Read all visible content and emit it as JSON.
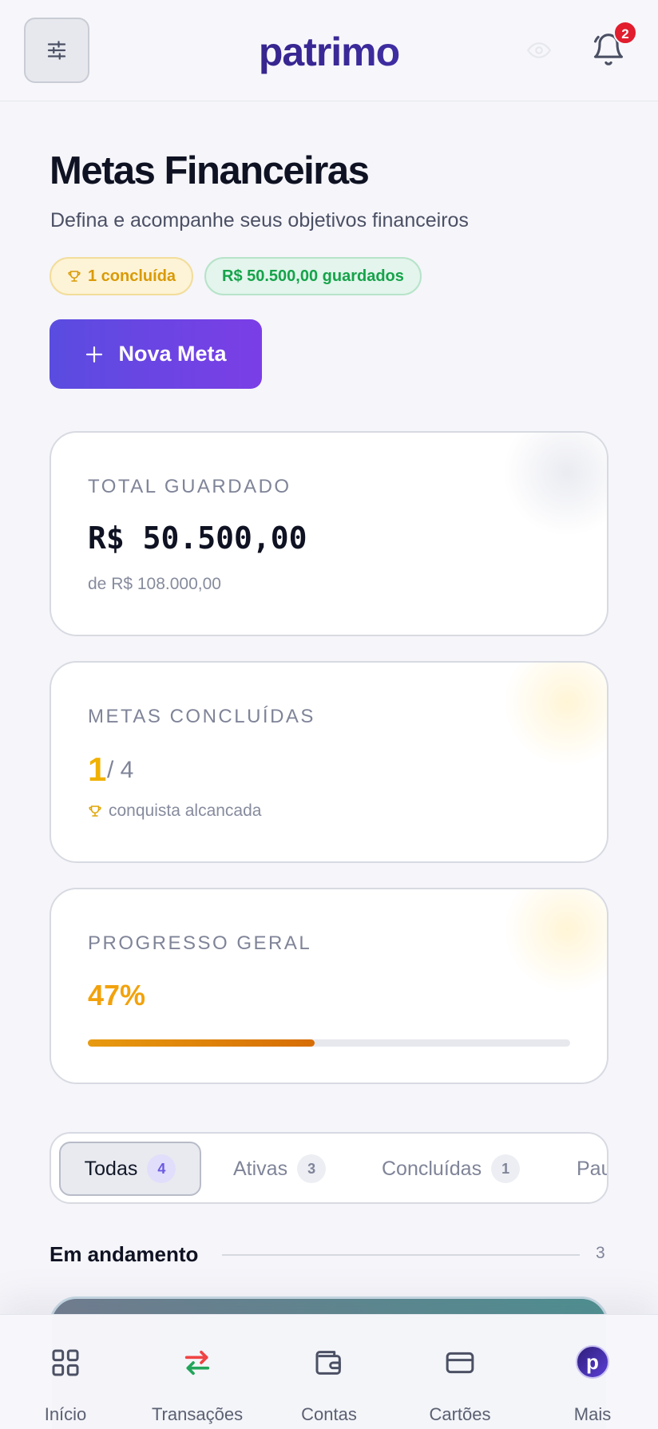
{
  "header": {
    "logo": "patrimo",
    "notification_count": "2"
  },
  "page": {
    "title": "Metas Financeiras",
    "subtitle": "Defina e acompanhe seus objetivos financeiros",
    "chip_completed": "1 concluída",
    "chip_saved": "R$ 50.500,00 guardados",
    "new_button": "Nova Meta"
  },
  "cards": {
    "total": {
      "label": "TOTAL GUARDADO",
      "value": "R$ 50.500,00",
      "sub": "de R$ 108.000,00"
    },
    "completed": {
      "label": "METAS CONCLUÍDAS",
      "done": "1",
      "total": "/ 4",
      "note": "conquista alcancada"
    },
    "progress": {
      "label": "PROGRESSO GERAL",
      "percent_text": "47%",
      "fraction": 0.47
    }
  },
  "tabs": [
    {
      "label": "Todas",
      "count": "4"
    },
    {
      "label": "Ativas",
      "count": "3"
    },
    {
      "label": "Concluídas",
      "count": "1"
    },
    {
      "label": "Pau",
      "count": ""
    }
  ],
  "section": {
    "title": "Em andamento",
    "count": "3"
  },
  "bottom_nav": [
    {
      "label": "Início",
      "icon": "grid-icon"
    },
    {
      "label": "Transações",
      "icon": "transfer-arrows-icon"
    },
    {
      "label": "Contas",
      "icon": "wallet-icon"
    },
    {
      "label": "Cartões",
      "icon": "credit-card-icon"
    },
    {
      "label": "Mais",
      "icon": "avatar-icon",
      "avatar_letter": "p"
    }
  ],
  "colors": {
    "accent": "#5b4ce0",
    "gold": "#f0b100",
    "green": "#16a34a",
    "orange": "#f2a20c",
    "danger": "#e11d2e"
  }
}
